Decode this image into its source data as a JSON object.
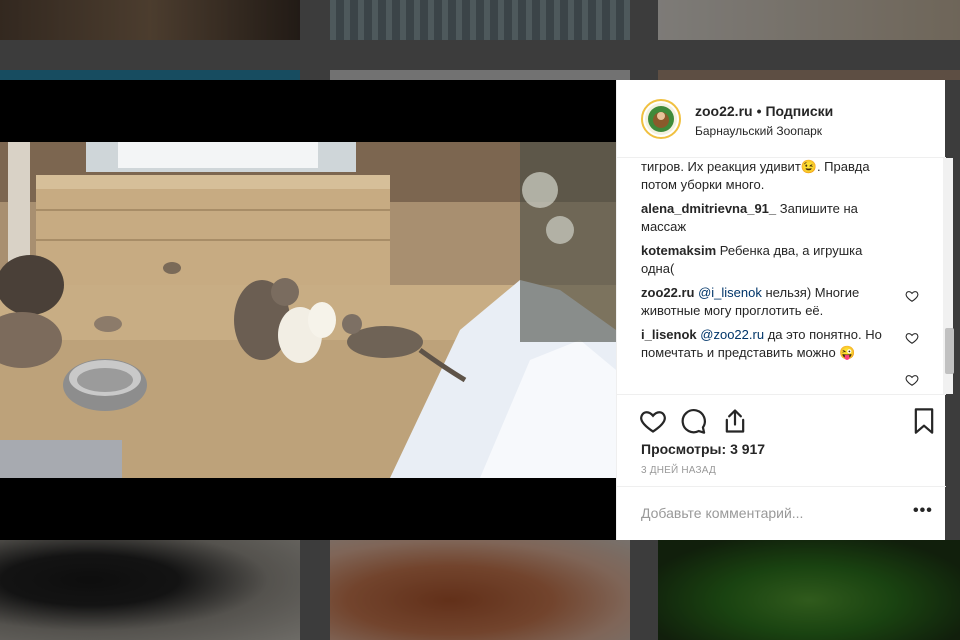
{
  "post": {
    "username": "zoo22.ru",
    "separator": "•",
    "follow_status": "Подписки",
    "location": "Барнаульский Зоопарк"
  },
  "comments": [
    {
      "username": "",
      "text": "тигров. Их реакция удивит😉. Правда потом уборки много.",
      "has_like": false
    },
    {
      "username": "alena_dmitrievna_91_",
      "text": "Запишите на массаж",
      "has_like": true
    },
    {
      "username": "kotemaksim",
      "text": "Ребенка два, а игрушка одна(",
      "has_like": true
    },
    {
      "username": "zoo22.ru",
      "mention": "@i_lisenok",
      "text": "нельзя) Многие животные могу проглотить её.",
      "has_like": true
    },
    {
      "username": "i_lisenok",
      "mention": "@zoo22.ru",
      "text": "да это понятно. Но помечтать и представить можно 😜",
      "has_like": true
    }
  ],
  "stats": {
    "views_label": "Просмотры:",
    "views_count": "3 917",
    "time_ago": "3 ДНЕЙ НАЗАД"
  },
  "composer": {
    "placeholder": "Добавьте комментарий...",
    "more": "•••"
  },
  "icons": {
    "like": "heart-icon",
    "comment": "comment-icon",
    "share": "share-icon",
    "save": "bookmark-icon",
    "comment_like": "heart-icon"
  }
}
